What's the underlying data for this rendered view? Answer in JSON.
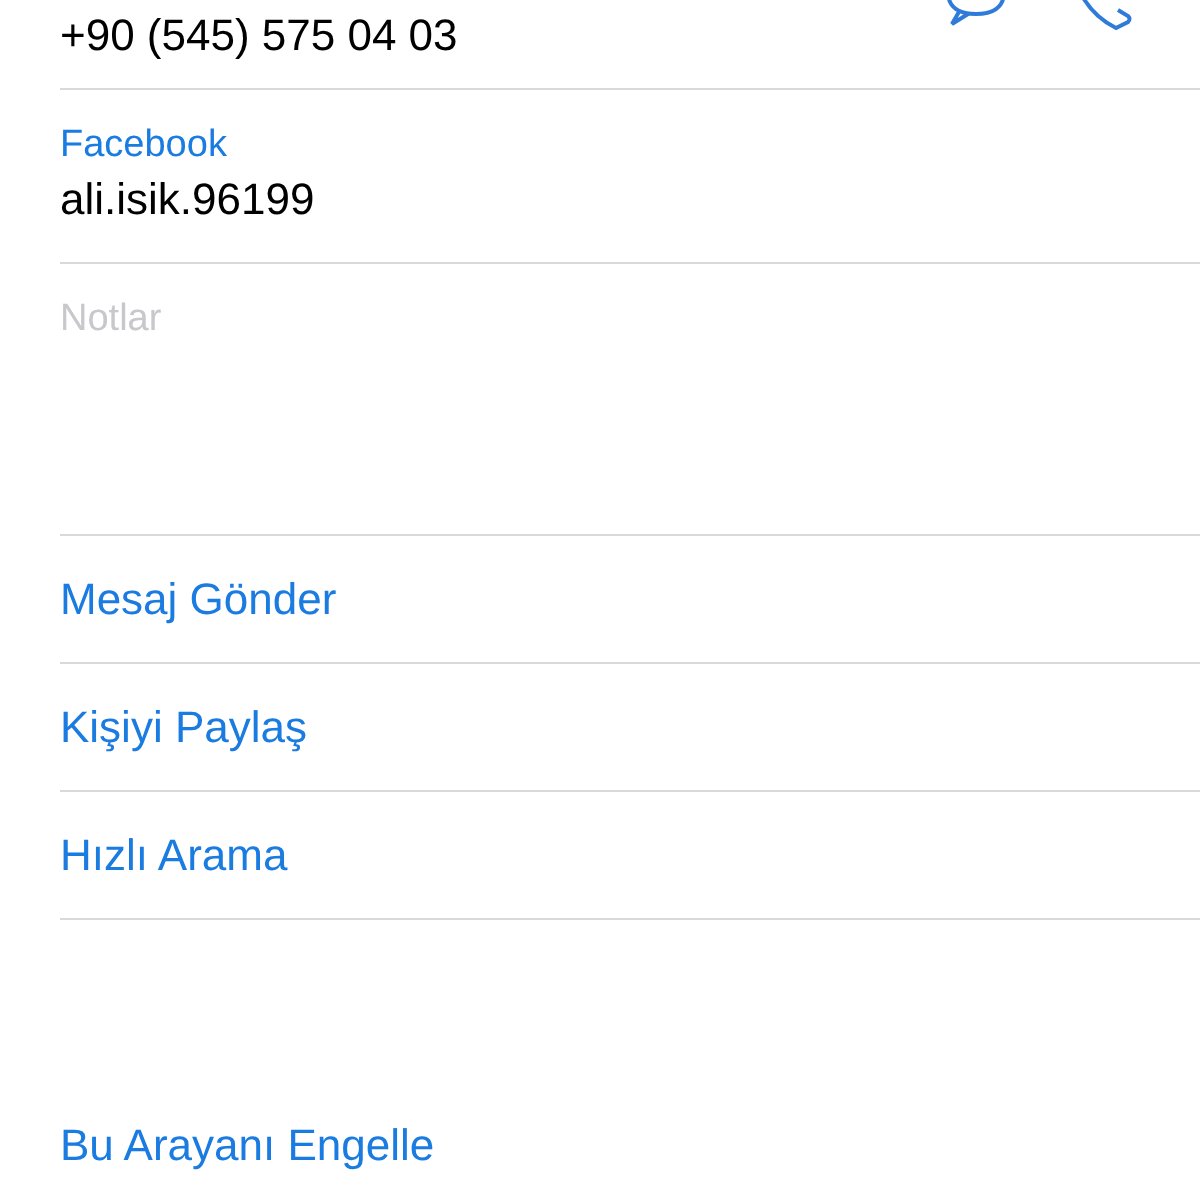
{
  "phone": {
    "number": "+90 (545) 575 04 03"
  },
  "fields": [
    {
      "label": "Facebook",
      "value": "ali.isik.96199"
    }
  ],
  "notes": {
    "placeholder": "Notlar"
  },
  "actions": [
    {
      "label": "Mesaj Gönder"
    },
    {
      "label": "Kişiyi Paylaş"
    },
    {
      "label": "Hızlı Arama"
    }
  ],
  "block": {
    "label": "Bu Arayanı Engelle"
  }
}
